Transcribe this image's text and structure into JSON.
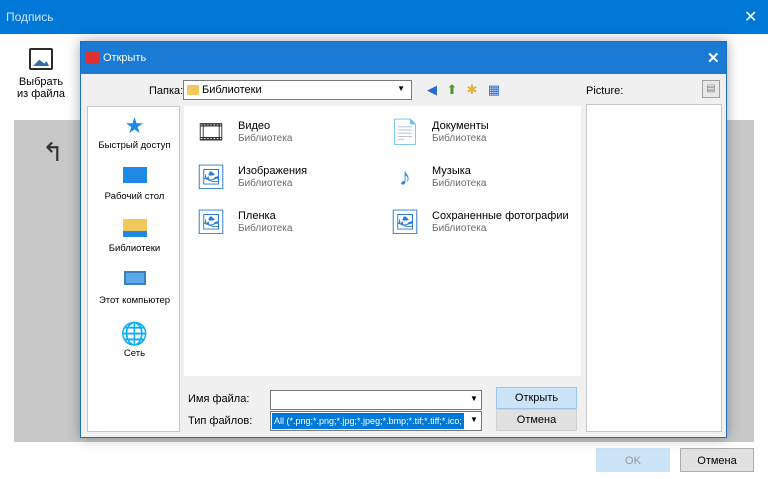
{
  "background_window": {
    "title": "Подпись",
    "toolbar_button_line1": "Выбрать",
    "toolbar_button_line2": "из файла",
    "ok_label": "OK",
    "cancel_label": "Отмена"
  },
  "dialog": {
    "title": "Открыть",
    "folder_label": "Папка:",
    "folder_value": "Библиотеки",
    "places": [
      {
        "label": "Быстрый доступ",
        "icon": "star-icon"
      },
      {
        "label": "Рабочий стол",
        "icon": "desktop-icon"
      },
      {
        "label": "Библиотеки",
        "icon": "libraries-icon"
      },
      {
        "label": "Этот компьютер",
        "icon": "computer-icon"
      },
      {
        "label": "Сеть",
        "icon": "network-icon"
      }
    ],
    "files": [
      {
        "name": "Видео",
        "subtitle": "Библиотека",
        "icon": "video-library-icon"
      },
      {
        "name": "Документы",
        "subtitle": "Библиотека",
        "icon": "documents-library-icon"
      },
      {
        "name": "Изображения",
        "subtitle": "Библиотека",
        "icon": "images-library-icon"
      },
      {
        "name": "Музыка",
        "subtitle": "Библиотека",
        "icon": "music-library-icon"
      },
      {
        "name": "Пленка",
        "subtitle": "Библиотека",
        "icon": "camera-roll-library-icon"
      },
      {
        "name": "Сохраненные фотографии",
        "subtitle": "Библиотека",
        "icon": "saved-pictures-library-icon"
      }
    ],
    "file_name_label": "Имя файла:",
    "file_name_value": "",
    "file_type_label": "Тип файлов:",
    "file_type_value": "All (*.png;*.png;*.jpg;*.jpeg;*.bmp;*.tif;*.tiff;*.ico;",
    "open_label": "Открыть",
    "cancel_label": "Отмена",
    "picture_label": "Picture:"
  },
  "colors": {
    "accent": "#0078d7",
    "titlebar": "#1b7bd4",
    "button_default": "#cce4f7"
  }
}
